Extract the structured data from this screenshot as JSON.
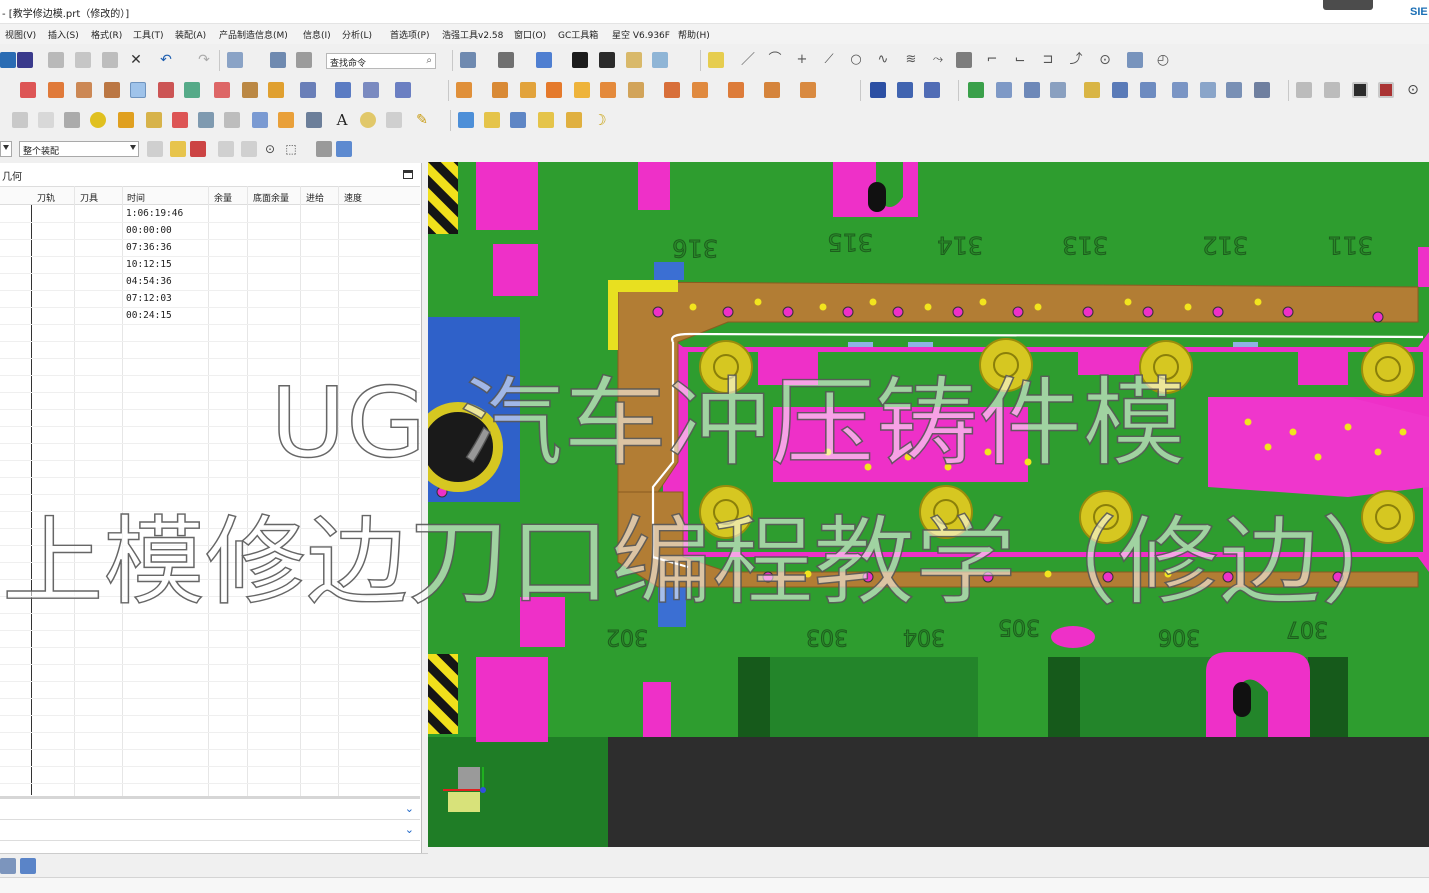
{
  "window": {
    "title": "- [教学修边模.prt（修改的）]",
    "brand": "SIE"
  },
  "menu": [
    "视图(V)",
    "插入(S)",
    "格式(R)",
    "工具(T)",
    "装配(A)",
    "产品制造信息(M)",
    "信息(I)",
    "分析(L)",
    "首选项(P)",
    "浩强工具v2.58",
    "窗口(O)",
    "GC工具箱",
    "星空 V6.936F",
    "帮助(H)"
  ],
  "toolbar": {
    "command_search_placeholder": "查找命令"
  },
  "selection_bar": {
    "scope": "整个装配"
  },
  "navigator": {
    "title": "几何",
    "columns": [
      "刀轨",
      "刀具",
      "时间",
      "余量",
      "底面余量",
      "进给",
      "速度"
    ],
    "time_values": [
      "1:06:19:46",
      "00:00:00",
      "07:36:36",
      "10:12:15",
      "04:54:36",
      "07:12:03",
      "00:24:15"
    ]
  },
  "model_labels": {
    "top": [
      "316",
      "315",
      "314",
      "313",
      "312",
      "311"
    ],
    "bottom": [
      "302",
      "303",
      "304",
      "305",
      "306",
      "307"
    ]
  },
  "overlay_text": {
    "line1": "UG 汽车冲压铸件模",
    "line2": "上模修边刀口编程教学（修边）"
  },
  "colors": {
    "model_green": "#2e9d2f",
    "magenta": "#ee30c8",
    "bronze": "#b27d34",
    "yellow": "#e8e020",
    "machine_bed": "#2d2d2d"
  }
}
